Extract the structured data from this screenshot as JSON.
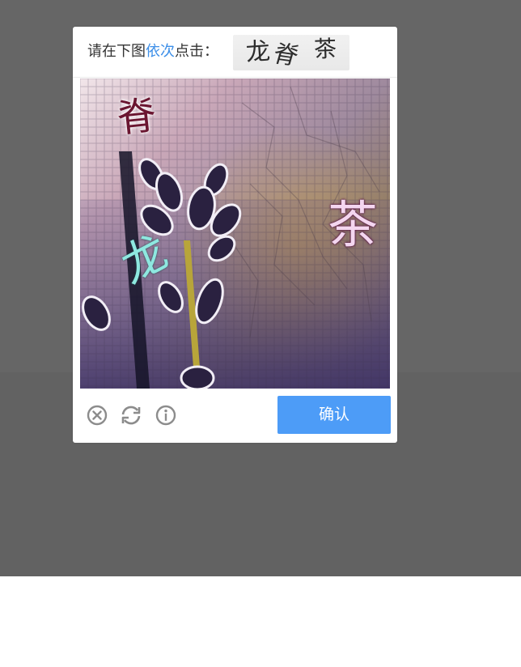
{
  "captcha": {
    "instruction_prefix": "请在下图",
    "instruction_highlight": "依次",
    "instruction_suffix": "点击：",
    "target_chars": [
      "龙",
      "脊",
      "茶"
    ],
    "image_chars": [
      {
        "char": "脊",
        "color": "#6a1530"
      },
      {
        "char": "龙",
        "color": "#8ee8e0"
      },
      {
        "char": "茶",
        "color": "#f4d6f0"
      }
    ],
    "confirm_label": "确认",
    "icons": [
      "close-icon",
      "refresh-icon",
      "info-icon"
    ],
    "colors": {
      "overlay": "#666666",
      "accent": "#3d8fe8",
      "button": "#4d9cf7"
    }
  }
}
